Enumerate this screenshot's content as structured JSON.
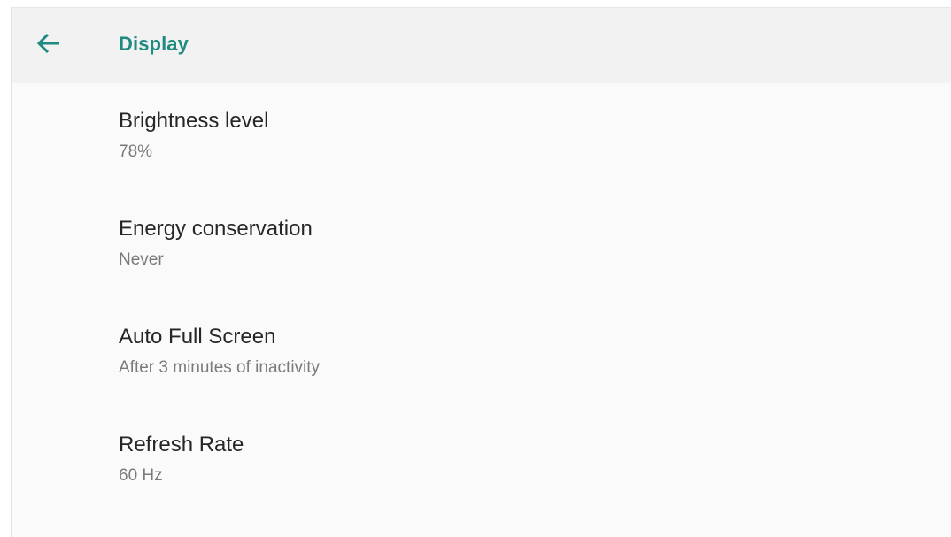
{
  "colors": {
    "accent": "#1e8a80",
    "primary_text": "#262626",
    "secondary_text": "#7a7a7a",
    "appbar_bg": "#f2f2f2",
    "content_bg": "#fafafa"
  },
  "header": {
    "back_icon": "arrow-left-icon",
    "title": "Display"
  },
  "settings": [
    {
      "title": "Brightness level",
      "value": "78%"
    },
    {
      "title": "Energy conservation",
      "value": "Never"
    },
    {
      "title": "Auto Full Screen",
      "value": "After 3 minutes of inactivity"
    },
    {
      "title": "Refresh Rate",
      "value": "60 Hz"
    }
  ]
}
